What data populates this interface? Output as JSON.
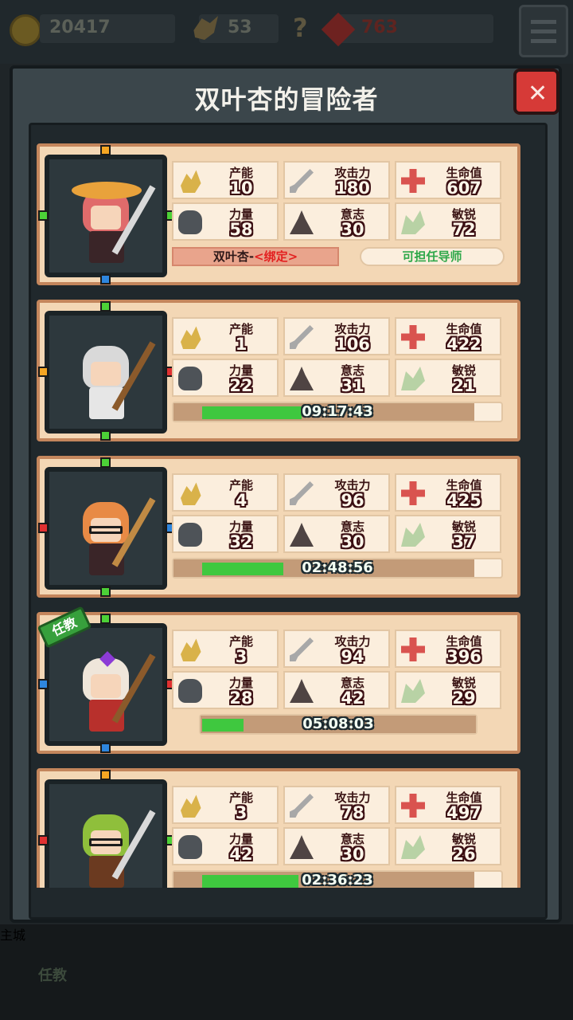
{
  "hud": {
    "gold": "20417",
    "ore": "53",
    "unknown": "?",
    "gems": "763"
  },
  "modal": {
    "title": "双叶杏的冒险者",
    "close_label": "✕"
  },
  "labels": {
    "production": "产能",
    "attack": "攻击力",
    "hp": "生命值",
    "strength": "力量",
    "willpower": "意志",
    "agility": "敏锐"
  },
  "adventurers": [
    {
      "production": "10",
      "attack": "180",
      "hp": "607",
      "strength": "58",
      "willpower": "30",
      "agility": "72",
      "name": "双叶杏-",
      "bind_tag": "<绑定>",
      "mentor_label": "可担任导师",
      "hair_color": "#e06b6b"
    },
    {
      "production": "1",
      "attack": "106",
      "hp": "422",
      "strength": "22",
      "willpower": "31",
      "agility": "21",
      "timer": "09:17:43",
      "progress": 0.33,
      "hair_color": "#d9d9d9"
    },
    {
      "production": "4",
      "attack": "96",
      "hp": "425",
      "strength": "32",
      "willpower": "30",
      "agility": "37",
      "timer": "02:48:56",
      "progress": 0.27,
      "hair_color": "#e88a45"
    },
    {
      "production": "3",
      "attack": "94",
      "hp": "396",
      "strength": "28",
      "willpower": "42",
      "agility": "29",
      "timer": "05:08:03",
      "progress": 0.15,
      "badge": "任教",
      "hair_color": "#efe6da"
    },
    {
      "production": "3",
      "attack": "78",
      "hp": "497",
      "strength": "42",
      "willpower": "30",
      "agility": "26",
      "timer": "02:36:23",
      "progress": 0.32,
      "hair_color": "#8fbf3b"
    }
  ],
  "nav": {
    "badge": "任教",
    "center_label": "主城"
  }
}
